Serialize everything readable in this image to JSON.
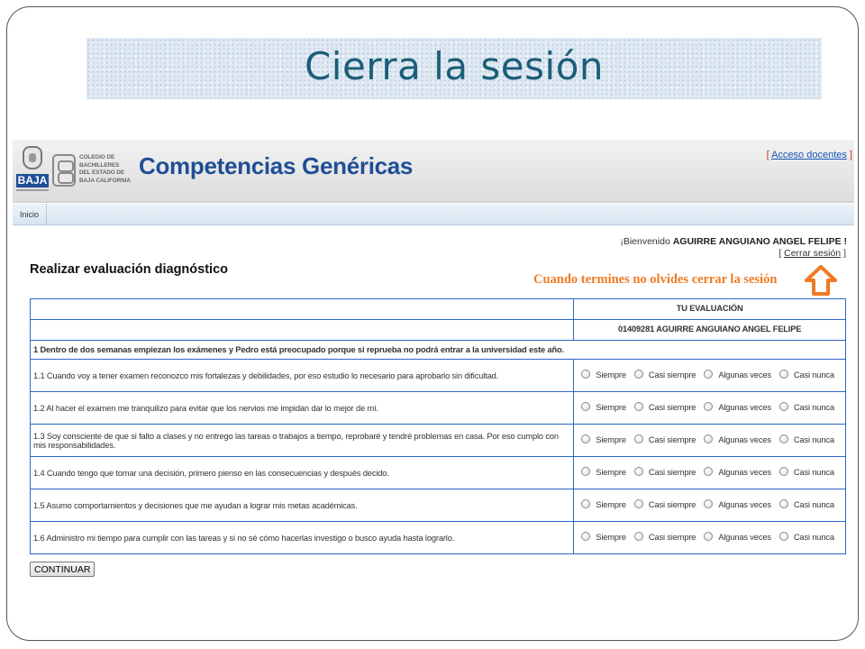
{
  "slide": {
    "title": "Cierra la sesión"
  },
  "header": {
    "logo_baja_text": "BAJA",
    "logo_cobach_text": "COLEGIO DE\nBACHILLERES\nDEL ESTADO DE\nBAJA CALIFORNIA",
    "site_title": "Competencias Genéricas",
    "top_link": "Acceso docentes"
  },
  "nav": {
    "items": [
      "Inicio"
    ]
  },
  "user": {
    "welcome_prefix": "¡Bienvenido",
    "name": "AGUIRRE ANGUIANO ANGEL FELIPE !",
    "logout_label": "Cerrar sesión"
  },
  "main": {
    "heading": "Realizar evaluación diagnóstico",
    "reminder": "Cuando termines no olvides cerrar la sesión",
    "arrow_color": "#f07a22"
  },
  "table": {
    "header_top": "TU EVALUACIÓN",
    "header_student": "01409281 AGUIRRE ANGUIANO ANGEL FELIPE",
    "block_title": "1 Dentro de dos semanas empiezan los exámenes y Pedro está preocupado porque si reprueba no podrá entrar a la universidad este año.",
    "options": [
      "Siempre",
      "Casi siempre",
      "Algunas veces",
      "Casi nunca"
    ],
    "questions": [
      "1.1 Cuando voy a tener examen reconozco mis fortalezas y debilidades, por eso estudio lo necesario para aprobarlo sin dificultad.",
      "1.2 Al hacer el examen me tranquilizo para evitar que los nervios me impidan dar lo mejor de mí.",
      "1.3 Soy consciente de que si falto a clases y no entrego las tareas o trabajos a tiempo, reprobaré y tendré problemas en casa. Por eso cumplo con mis responsabilidades.",
      "1.4 Cuando tengo que tomar una decisión, primero pienso en las consecuencias y después decido.",
      "1.5 Asumo comportamientos y decisiones que me ayudan a lograr mis metas académicas.",
      "1.6 Administro mi tiempo para cumplir con las tareas y si no sé cómo hacerlas investigo o busco ayuda hasta lograrlo."
    ]
  },
  "actions": {
    "continue_label": "CONTINUAR"
  },
  "colors": {
    "accent": "#1f4e96",
    "title": "#1b5e78",
    "table_border": "#2a67c7",
    "reminder": "#f07a22"
  }
}
